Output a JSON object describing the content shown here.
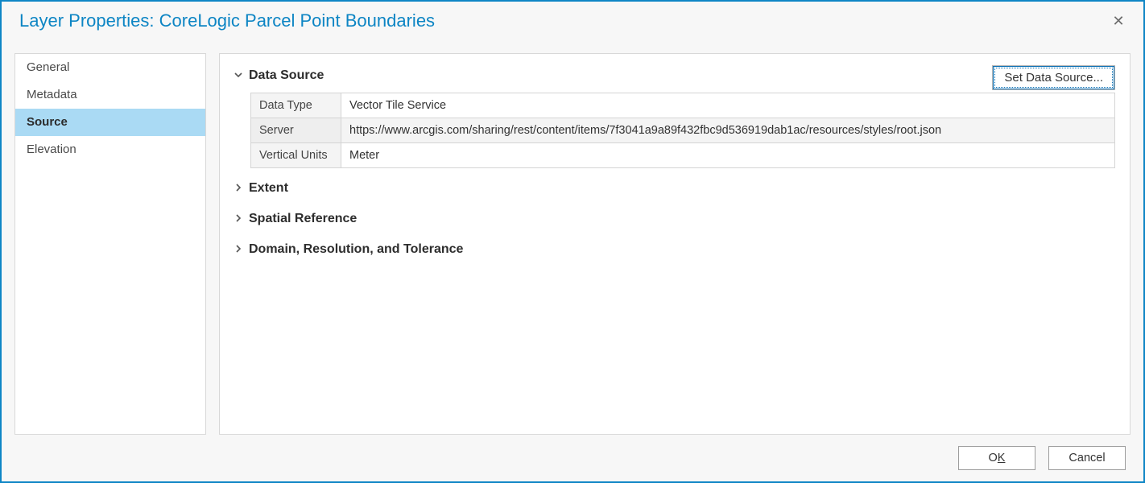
{
  "title": "Layer Properties: CoreLogic Parcel Point Boundaries",
  "sidebar": {
    "items": [
      {
        "label": "General"
      },
      {
        "label": "Metadata"
      },
      {
        "label": "Source"
      },
      {
        "label": "Elevation"
      }
    ],
    "activeIndex": 2
  },
  "main": {
    "setDataSource": "Set Data Source...",
    "sections": {
      "dataSource": {
        "label": "Data Source",
        "rows": [
          {
            "key": "Data Type",
            "value": "Vector Tile Service"
          },
          {
            "key": "Server",
            "value": "https://www.arcgis.com/sharing/rest/content/items/7f3041a9a89f432fbc9d536919dab1ac/resources/styles/root.json"
          },
          {
            "key": "Vertical Units",
            "value": "Meter"
          }
        ]
      },
      "extent": {
        "label": "Extent"
      },
      "spatialRef": {
        "label": "Spatial Reference"
      },
      "domain": {
        "label": "Domain, Resolution, and Tolerance"
      }
    }
  },
  "footer": {
    "ok_pre": "O",
    "ok_key": "K",
    "cancel": "Cancel"
  }
}
